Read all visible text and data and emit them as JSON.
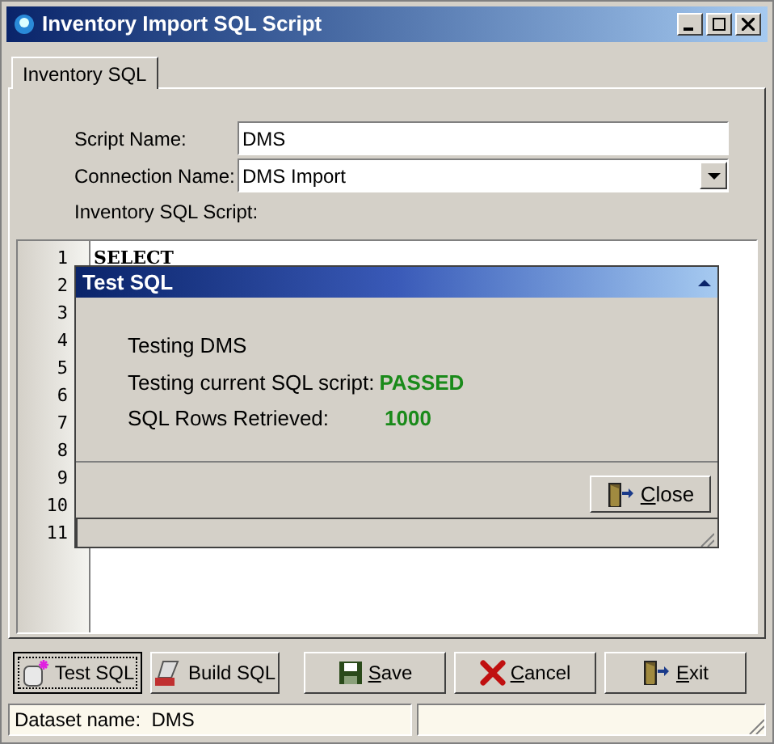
{
  "window": {
    "title": "Inventory Import SQL Script"
  },
  "tabs": [
    {
      "label": "Inventory SQL",
      "selected": true
    }
  ],
  "form": {
    "script_name_label": "Script Name:",
    "script_name": "DMS",
    "connection_label": "Connection Name:",
    "connection": "DMS Import",
    "script_label": "Inventory SQL Script:"
  },
  "editor": {
    "line_numbers": [
      "1",
      "2",
      "3",
      "4",
      "5",
      "6",
      "7",
      "8",
      "9",
      "10",
      "11"
    ],
    "lines": [
      "SELECT"
    ]
  },
  "dialog": {
    "title": "Test SQL",
    "line1": "Testing DMS",
    "line2_label": "Testing current SQL script:",
    "line2_value": "PASSED",
    "line3_label": "SQL Rows Retrieved:",
    "line3_value": "1000",
    "close": {
      "label": "Close",
      "mnemonic": true
    }
  },
  "buttons": [
    {
      "kind": "test",
      "label": "Test SQL",
      "focused": true
    },
    {
      "kind": "build",
      "label": "Build SQL",
      "focused": false
    },
    {
      "kind": "save",
      "label": "Save",
      "mnemonic": true,
      "focused": false
    },
    {
      "kind": "cancel",
      "label": "Cancel",
      "mnemonic": true,
      "focused": false
    },
    {
      "kind": "exit",
      "label": "Exit",
      "mnemonic": true,
      "focused": false
    }
  ],
  "status_bar": {
    "dataset": "Dataset name:  DMS"
  }
}
